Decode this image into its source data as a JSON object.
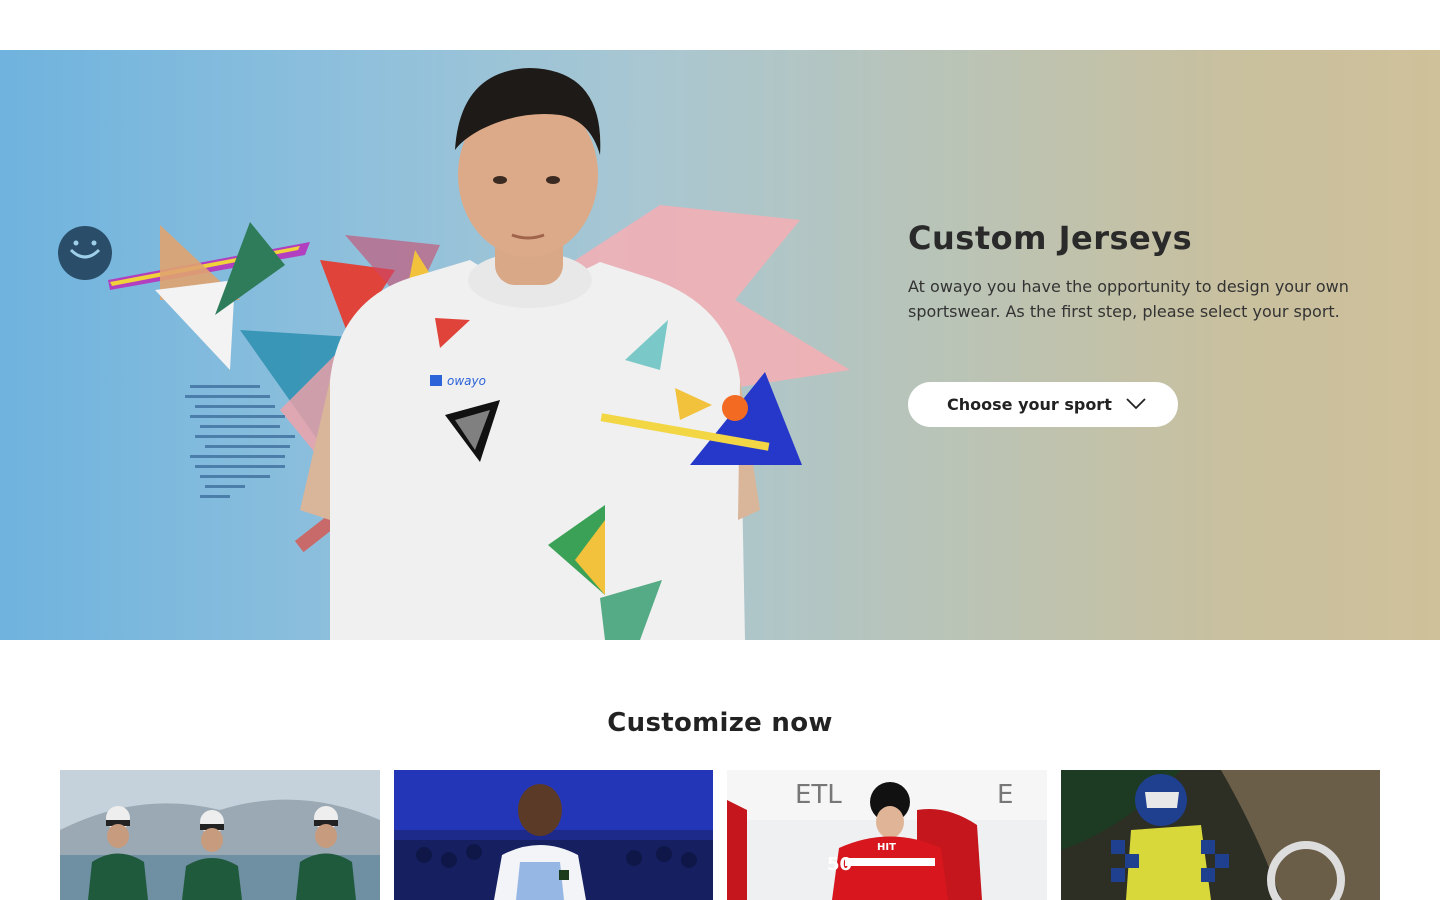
{
  "hero": {
    "title": "Custom Jerseys",
    "description": "At owayo you have the opportunity to design your own sportswear. As the first step, please select your sport.",
    "sport_button_label": "Choose your sport",
    "shirt_logo_text": "owayo"
  },
  "customize": {
    "title": "Customize now",
    "cards": [
      {
        "image": "cycling-team-photo"
      },
      {
        "image": "basketball-player-photo"
      },
      {
        "image": "ice-hockey-player-photo",
        "banner_text": "ETL",
        "jersey_number": "50",
        "sponsor_text": "HIT"
      },
      {
        "image": "motocross-rider-photo"
      }
    ]
  },
  "colors": {
    "hero_gradient_start": "#6fb3de",
    "hero_gradient_end": "#cfc19a",
    "title": "#2a2a2a",
    "button_bg": "#ffffff"
  }
}
